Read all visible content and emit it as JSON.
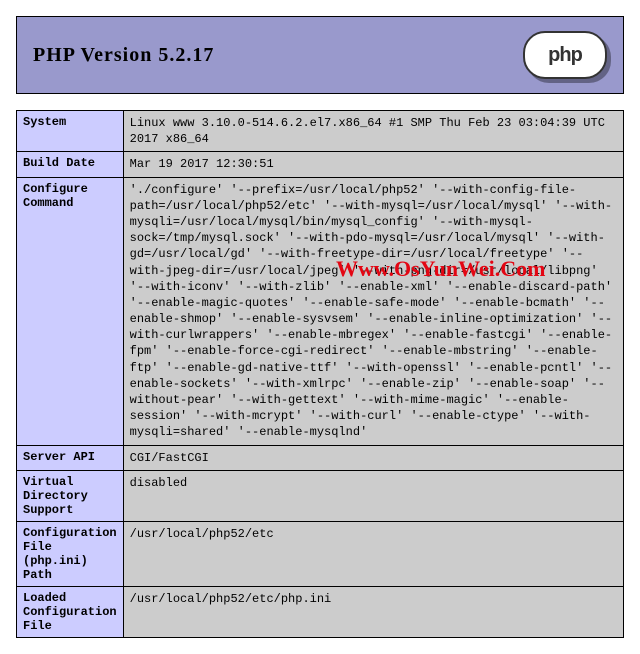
{
  "header": {
    "title": "PHP Version 5.2.17",
    "logo_text": "php"
  },
  "rows": {
    "system": {
      "label": "System",
      "value": "Linux www 3.10.0-514.6.2.el7.x86_64 #1 SMP Thu Feb 23 03:04:39 UTC 2017 x86_64"
    },
    "build_date": {
      "label": "Build Date",
      "value": "Mar 19 2017 12:30:51"
    },
    "configure": {
      "label": "Configure Command",
      "value": "'./configure' '--prefix=/usr/local/php52' '--with-config-file-path=/usr/local/php52/etc' '--with-mysql=/usr/local/mysql' '--with-mysqli=/usr/local/mysql/bin/mysql_config' '--with-mysql-sock=/tmp/mysql.sock' '--with-pdo-mysql=/usr/local/mysql' '--with-gd=/usr/local/gd' '--with-freetype-dir=/usr/local/freetype' '--with-jpeg-dir=/usr/local/jpeg' '--with-png-dir=/usr/local/libpng' '--with-iconv' '--with-zlib' '--enable-xml' '--enable-discard-path' '--enable-magic-quotes' '--enable-safe-mode' '--enable-bcmath' '--enable-shmop' '--enable-sysvsem' '--enable-inline-optimization' '--with-curlwrappers' '--enable-mbregex' '--enable-fastcgi' '--enable-fpm' '--enable-force-cgi-redirect' '--enable-mbstring' '--enable-ftp' '--enable-gd-native-ttf' '--with-openssl' '--enable-pcntl' '--enable-sockets' '--with-xmlrpc' '--enable-zip' '--enable-soap' '--without-pear' '--with-gettext' '--with-mime-magic' '--enable-session' '--with-mcrypt' '--with-curl' '--enable-ctype' '--with-mysqli=shared' '--enable-mysqlnd'"
    },
    "server_api": {
      "label": "Server API",
      "value": "CGI/FastCGI"
    },
    "vdir": {
      "label": "Virtual Directory Support",
      "value": "disabled"
    },
    "cfg_path": {
      "label": "Configuration File (php.ini) Path",
      "value": "/usr/local/php52/etc"
    },
    "loaded_cfg": {
      "label": "Loaded Configuration File",
      "value": "/usr/local/php52/etc/php.ini"
    }
  },
  "watermark": "Www.OsYunWei.Com"
}
